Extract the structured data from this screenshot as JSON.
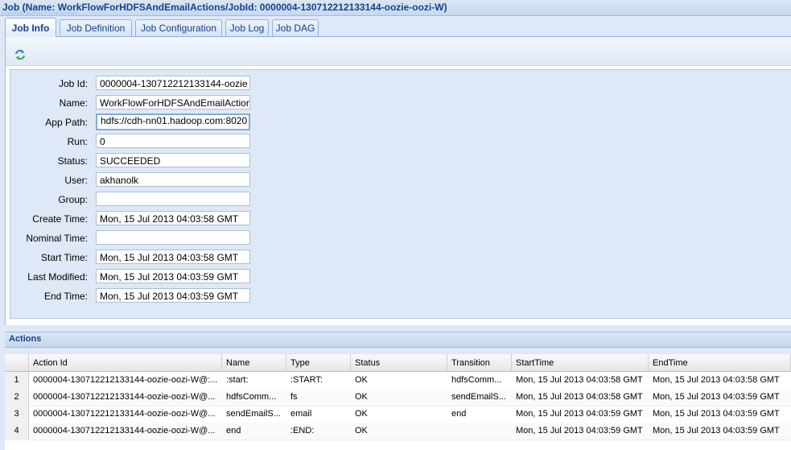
{
  "window": {
    "title": "Job (Name: WorkFlowForHDFSAndEmailActions/JobId: 0000004-130712212133144-oozie-oozi-W)",
    "ghost_title": "Oozie Web Console"
  },
  "tabs": [
    {
      "label": "Job Info",
      "active": true
    },
    {
      "label": "Job Definition"
    },
    {
      "label": "Job Configuration"
    },
    {
      "label": "Job Log"
    },
    {
      "label": "Job DAG"
    }
  ],
  "toolbar": {
    "refresh_icon": "refresh-icon"
  },
  "form": {
    "job_id": {
      "label": "Job Id:",
      "value": "0000004-130712212133144-oozie"
    },
    "name": {
      "label": "Name:",
      "value": "WorkFlowForHDFSAndEmailActions"
    },
    "app_path": {
      "label": "App Path:",
      "value": "hdfs://cdh-nn01.hadoop.com:8020"
    },
    "run": {
      "label": "Run:",
      "value": "0"
    },
    "status": {
      "label": "Status:",
      "value": "SUCCEEDED"
    },
    "user": {
      "label": "User:",
      "value": "akhanolk"
    },
    "group": {
      "label": "Group:",
      "value": ""
    },
    "create_time": {
      "label": "Create Time:",
      "value": "Mon, 15 Jul 2013 04:03:58 GMT"
    },
    "nominal_time": {
      "label": "Nominal Time:",
      "value": ""
    },
    "start_time": {
      "label": "Start Time:",
      "value": "Mon, 15 Jul 2013 04:03:58 GMT"
    },
    "last_modified": {
      "label": "Last Modified:",
      "value": "Mon, 15 Jul 2013 04:03:59 GMT"
    },
    "end_time": {
      "label": "End Time:",
      "value": "Mon, 15 Jul 2013 04:03:59 GMT"
    }
  },
  "actions": {
    "title": "Actions",
    "columns": [
      "Action Id",
      "Name",
      "Type",
      "Status",
      "Transition",
      "StartTime",
      "EndTime"
    ],
    "rows": [
      {
        "n": "1",
        "action_id": "0000004-130712212133144-oozie-oozi-W@:...",
        "name": ":start:",
        "type": ":START:",
        "status": "OK",
        "transition": "hdfsComm...",
        "start": "Mon, 15 Jul 2013 04:03:58 GMT",
        "end": "Mon, 15 Jul 2013 04:03:58 GMT"
      },
      {
        "n": "2",
        "action_id": "0000004-130712212133144-oozie-oozi-W@...",
        "name": "hdfsComm...",
        "type": "fs",
        "status": "OK",
        "transition": "sendEmailS...",
        "start": "Mon, 15 Jul 2013 04:03:58 GMT",
        "end": "Mon, 15 Jul 2013 04:03:59 GMT"
      },
      {
        "n": "3",
        "action_id": "0000004-130712212133144-oozie-oozi-W@...",
        "name": "sendEmailS...",
        "type": "email",
        "status": "OK",
        "transition": "end",
        "start": "Mon, 15 Jul 2013 04:03:59 GMT",
        "end": "Mon, 15 Jul 2013 04:03:59 GMT"
      },
      {
        "n": "4",
        "action_id": "0000004-130712212133144-oozie-oozi-W@...",
        "name": "end",
        "type": ":END:",
        "status": "OK",
        "transition": "",
        "start": "Mon, 15 Jul 2013 04:03:59 GMT",
        "end": "Mon, 15 Jul 2013 04:03:59 GMT"
      }
    ]
  }
}
